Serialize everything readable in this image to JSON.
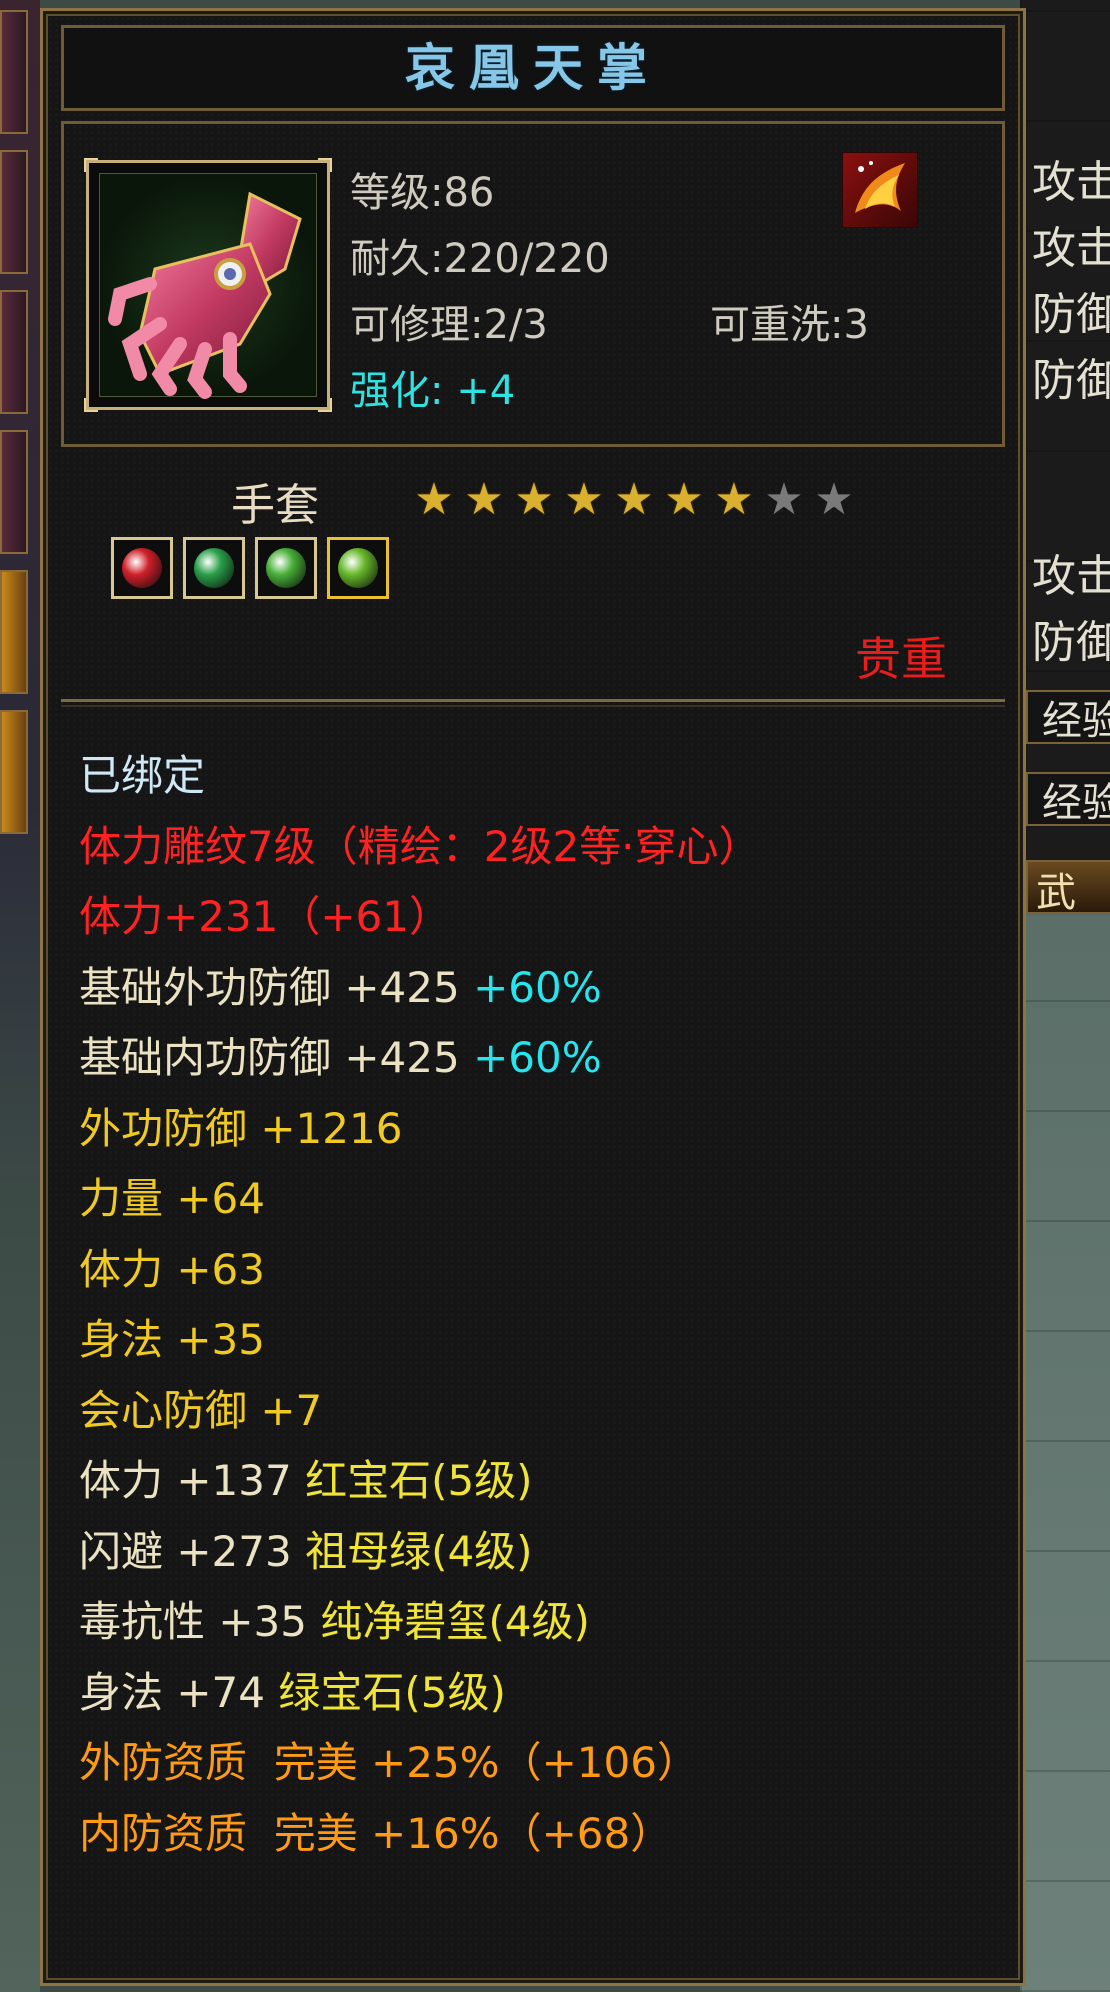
{
  "item": {
    "name": "哀凰天掌",
    "level": "等级:86",
    "durability": "耐久:220/220",
    "repairable": "可修理:2/3",
    "rewashable": "可重洗:3",
    "enhance": "强化: +4",
    "type": "手套",
    "stars_filled": 7,
    "stars_total": 9,
    "rarity": "贵重",
    "gems": [
      {
        "name": "red-gem",
        "color": "#d0202a"
      },
      {
        "name": "green-gem",
        "color": "#2aa04a"
      },
      {
        "name": "green-gem",
        "color": "#48b038"
      },
      {
        "name": "green-gem",
        "color": "#66b82a"
      }
    ]
  },
  "properties": [
    [
      {
        "text": "已绑定",
        "color": "lb"
      }
    ],
    [
      {
        "text": "体力雕纹7级（精绘：2级2等·穿心）",
        "color": "rd"
      }
    ],
    [
      {
        "text": "体力+231（+61）",
        "color": "rd"
      }
    ],
    [
      {
        "text": "基础外功防御 +425 ",
        "color": "wt"
      },
      {
        "text": "+60%",
        "color": "cy"
      }
    ],
    [
      {
        "text": "基础内功防御 +425 ",
        "color": "wt"
      },
      {
        "text": "+60%",
        "color": "cy"
      }
    ],
    [
      {
        "text": "外功防御 +1216",
        "color": "yl"
      }
    ],
    [
      {
        "text": "力量 +64",
        "color": "yl"
      }
    ],
    [
      {
        "text": "体力 +63",
        "color": "yl"
      }
    ],
    [
      {
        "text": "身法 +35",
        "color": "yl"
      }
    ],
    [
      {
        "text": "会心防御 +7",
        "color": "yl"
      }
    ],
    [
      {
        "text": "体力 +137 ",
        "color": "wt"
      },
      {
        "text": "红宝石(5级)",
        "color": "ye"
      }
    ],
    [
      {
        "text": "闪避 +273 ",
        "color": "wt"
      },
      {
        "text": "祖母绿(4级)",
        "color": "ye"
      }
    ],
    [
      {
        "text": "毒抗性 +35 ",
        "color": "wt"
      },
      {
        "text": "纯净碧玺(4级)",
        "color": "ye"
      }
    ],
    [
      {
        "text": "身法 +74 ",
        "color": "wt"
      },
      {
        "text": "绿宝石(5级)",
        "color": "ye"
      }
    ],
    [
      {
        "text": "外防资质  完美 +25%（+106）",
        "color": "og"
      }
    ],
    [
      {
        "text": "内防资质  完美 +16%（+68）",
        "color": "og"
      }
    ]
  ],
  "side_panel": {
    "labels": [
      "攻击",
      "攻击",
      "防御",
      "防御",
      "攻击",
      "防御"
    ],
    "exp_labels": [
      "经验",
      "经验"
    ],
    "button": "武"
  }
}
